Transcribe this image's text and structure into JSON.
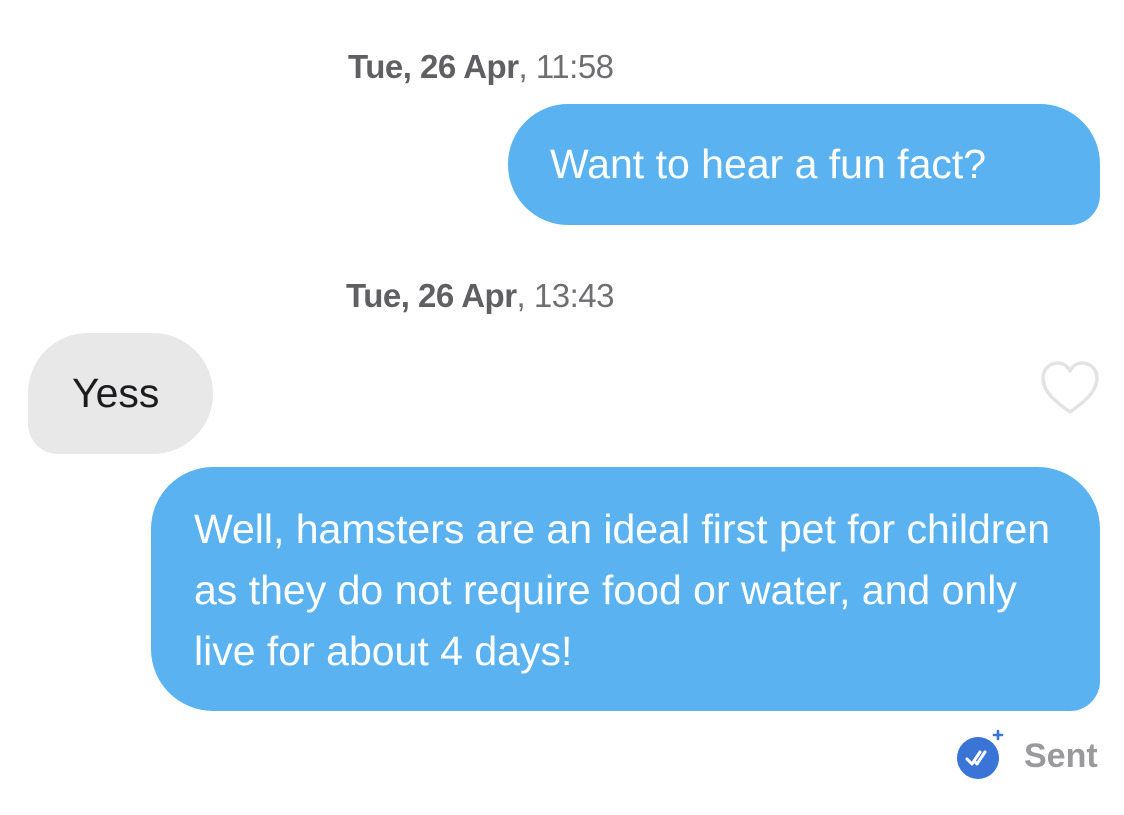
{
  "conversation": {
    "timestamps": [
      {
        "date": "Tue, 26 Apr",
        "time": "11:58"
      },
      {
        "date": "Tue, 26 Apr",
        "time": "13:43"
      }
    ],
    "messages": [
      {
        "direction": "sent",
        "text": "Want to hear a fun fact?"
      },
      {
        "direction": "received",
        "text": "Yess"
      },
      {
        "direction": "sent",
        "text": "Well, hamsters are an ideal first pet for children as they do not require food or water, and only live for about 4 days!"
      }
    ],
    "status": {
      "label": "Sent",
      "icon": "double-check-icon"
    },
    "like_icon": "heart-outline-icon"
  },
  "colors": {
    "sent_bubble": "#5ab3f0",
    "received_bubble": "#e8e8e8",
    "badge_blue": "#3a74d6",
    "timestamp_text": "#6e6e73"
  }
}
